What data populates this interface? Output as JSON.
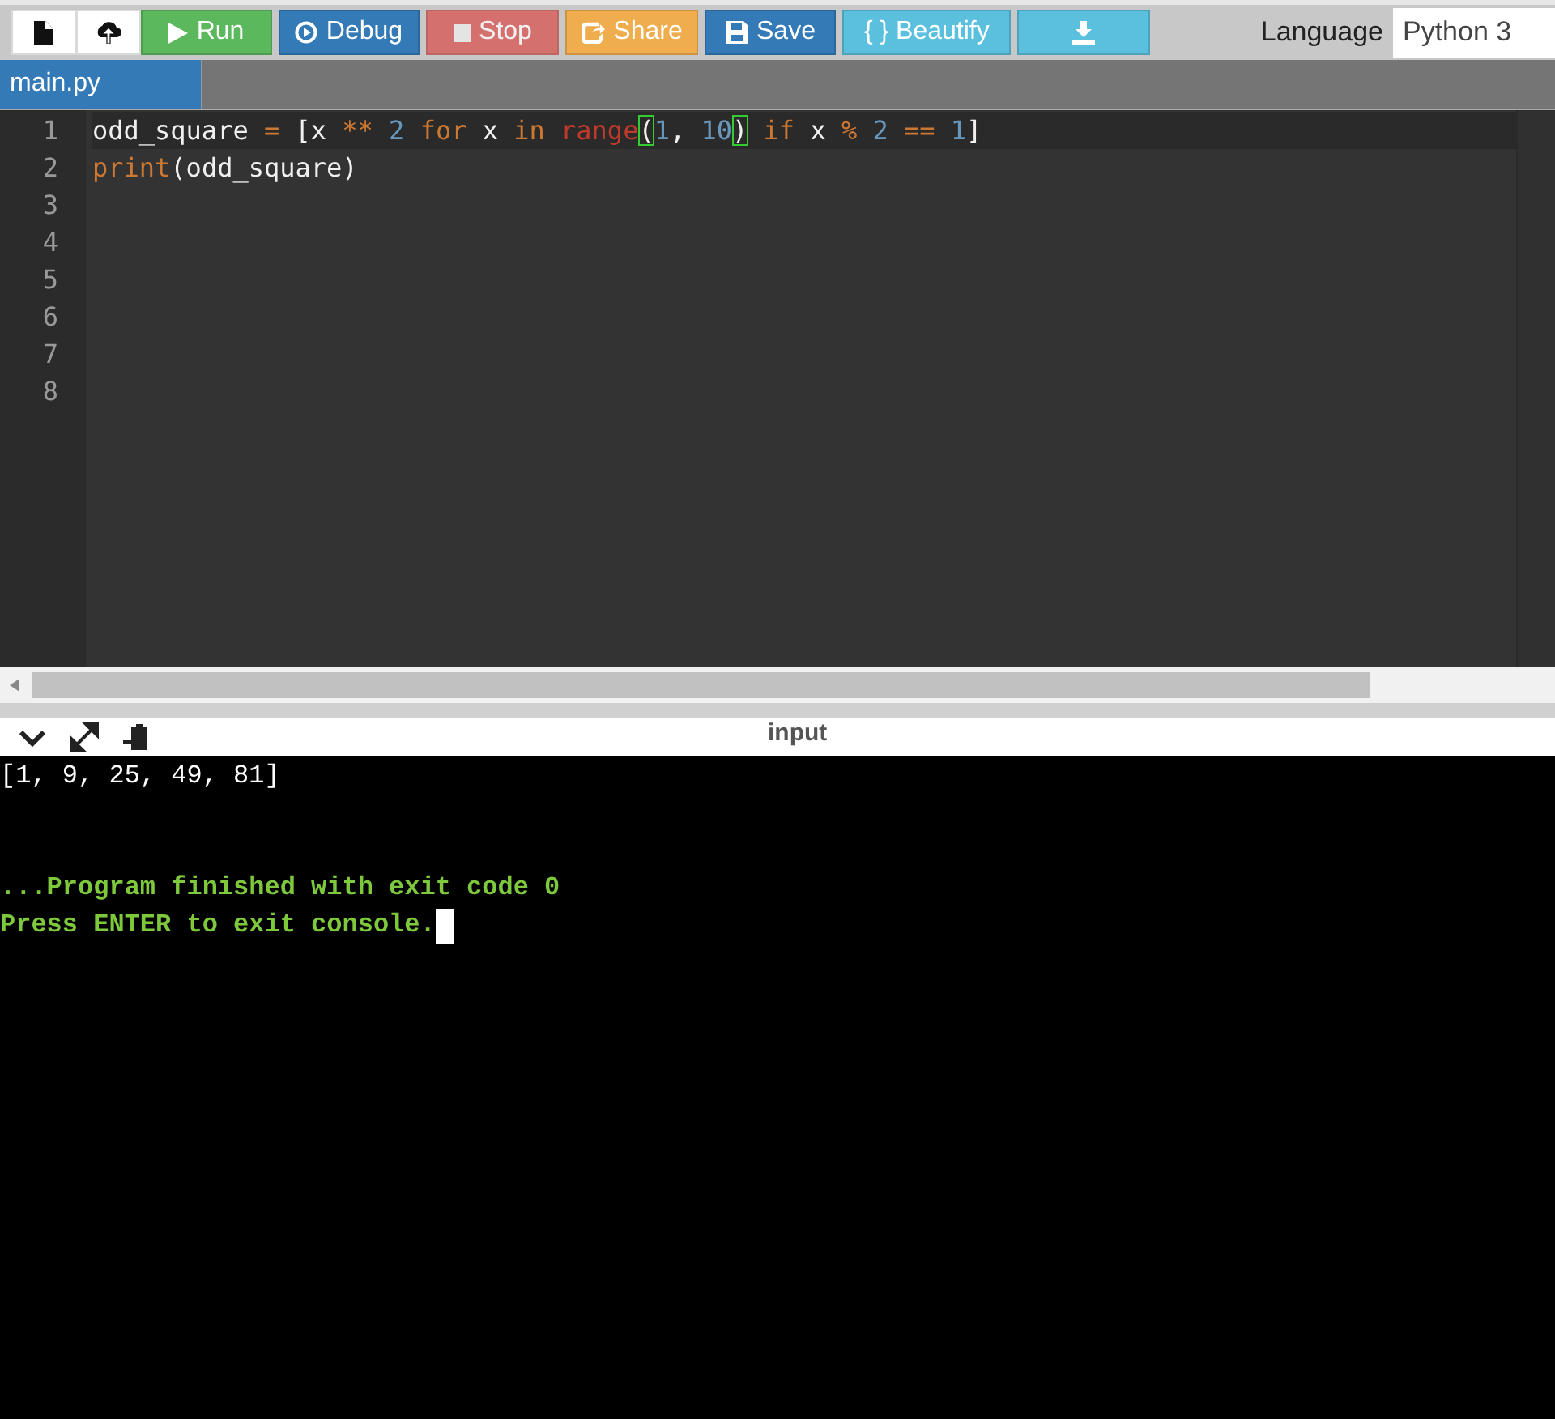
{
  "toolbar": {
    "buttons": [
      {
        "kind": "new"
      },
      {
        "kind": "upload"
      },
      {
        "kind": "run",
        "label": "Run"
      },
      {
        "kind": "debug",
        "label": "Debug"
      },
      {
        "kind": "stop",
        "label": "Stop",
        "disabled": true
      },
      {
        "kind": "share",
        "label": "Share"
      },
      {
        "kind": "save",
        "label": "Save"
      },
      {
        "kind": "beautify",
        "label": "{ } Beautify"
      },
      {
        "kind": "download"
      }
    ],
    "language_label": "Language",
    "language_value": "Python 3"
  },
  "tabs": [
    {
      "label": "main.py",
      "selected": true
    }
  ],
  "editor": {
    "lines": [
      {
        "number": "1",
        "tokens": [
          {
            "kind": "text",
            "text": "odd_square "
          },
          {
            "kind": "op",
            "text": "= "
          },
          {
            "kind": "text",
            "text": "[x "
          },
          {
            "kind": "op",
            "text": "** "
          },
          {
            "kind": "num",
            "text": "2 "
          },
          {
            "kind": "kw",
            "text": "for"
          },
          {
            "kind": "text",
            "text": " x "
          },
          {
            "kind": "kw",
            "text": "in "
          },
          {
            "kind": "builtin",
            "text": "range"
          },
          {
            "kind": "match",
            "text": "("
          },
          {
            "kind": "num",
            "text": "1"
          },
          {
            "kind": "text",
            "text": ", "
          },
          {
            "kind": "num",
            "text": "10"
          },
          {
            "kind": "match",
            "text": ")"
          },
          {
            "kind": "kw",
            "text": " if"
          },
          {
            "kind": "text",
            "text": " x "
          },
          {
            "kind": "op",
            "text": "% "
          },
          {
            "kind": "num",
            "text": "2 "
          },
          {
            "kind": "op",
            "text": "== "
          },
          {
            "kind": "num",
            "text": "1"
          },
          {
            "kind": "text",
            "text": "]"
          }
        ]
      },
      {
        "number": "2",
        "tokens": [
          {
            "kind": "kw",
            "text": "print"
          },
          {
            "kind": "text",
            "text": "(odd_square)"
          }
        ]
      },
      {
        "number": "3"
      },
      {
        "number": "4"
      },
      {
        "number": "5"
      },
      {
        "number": "6"
      },
      {
        "number": "7"
      },
      {
        "number": "8"
      }
    ]
  },
  "console": {
    "title": "input",
    "lines": [
      {
        "kind": "output",
        "text": "[1, 9, 25, 49, 81]"
      },
      {
        "kind": "blank"
      },
      {
        "kind": "blank"
      },
      {
        "kind": "status",
        "text": "...Program finished with exit code 0"
      },
      {
        "kind": "status",
        "text": "Press ENTER to exit console.",
        "cursor": true
      }
    ]
  }
}
